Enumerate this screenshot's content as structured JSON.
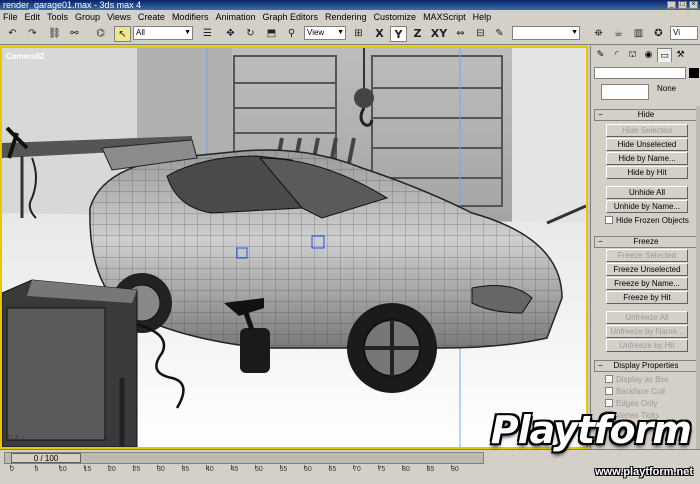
{
  "window": {
    "title": "render_garage01.max - 3ds max 4"
  },
  "menu": [
    "File",
    "Edit",
    "Tools",
    "Group",
    "Views",
    "Create",
    "Modifiers",
    "Animation",
    "Graph Editors",
    "Rendering",
    "Customize",
    "MAXScript",
    "Help"
  ],
  "toolbar": {
    "selection_filter": "All",
    "reference_coord": "View",
    "axes": [
      "X",
      "Y",
      "Z",
      "XY"
    ],
    "active_axis": "Y",
    "named_selection": "",
    "truncated_right": "Vi"
  },
  "viewport": {
    "label": "Camera02"
  },
  "command_panel": {
    "object_color": "#000000",
    "material_label": "None",
    "hide": {
      "title": "Hide",
      "buttons": [
        {
          "label": "Hide Selected",
          "enabled": false
        },
        {
          "label": "Hide Unselected",
          "enabled": true
        },
        {
          "label": "Hide by Name...",
          "enabled": true
        },
        {
          "label": "Hide by Hit",
          "enabled": true
        },
        {
          "label": "Unhide All",
          "enabled": true
        },
        {
          "label": "Unhide by Name...",
          "enabled": true
        }
      ],
      "checkbox": "Hide Frozen Objects"
    },
    "freeze": {
      "title": "Freeze",
      "buttons": [
        {
          "label": "Freeze Selected",
          "enabled": false
        },
        {
          "label": "Freeze Unselected",
          "enabled": true
        },
        {
          "label": "Freeze by Name...",
          "enabled": true
        },
        {
          "label": "Freeze by Hit",
          "enabled": true
        },
        {
          "label": "Unfreeze All",
          "enabled": false
        },
        {
          "label": "Unfreeze by Name...",
          "enabled": false
        },
        {
          "label": "Unfreeze by Hit",
          "enabled": false
        }
      ]
    },
    "display_properties": {
      "title": "Display Properties",
      "checkboxes": [
        "Display as Box",
        "Backface Cull",
        "Edges Only",
        "Vertex Ticks",
        "Trajectory"
      ]
    }
  },
  "timeline": {
    "slider_label": "0 / 100",
    "ticks": [
      "0",
      "5",
      "10",
      "15",
      "20",
      "25",
      "30",
      "35",
      "40",
      "45",
      "50",
      "55",
      "60",
      "65",
      "70",
      "75",
      "80",
      "85",
      "90"
    ]
  },
  "watermark": {
    "logo": "Playtform",
    "url": "www.playtform.net"
  }
}
